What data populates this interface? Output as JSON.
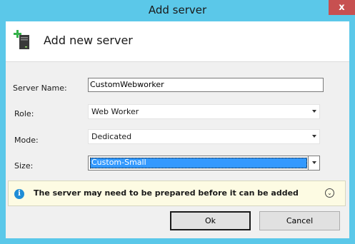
{
  "window": {
    "title": "Add server",
    "close_glyph": "x"
  },
  "header": {
    "title": "Add new server",
    "icon": "server-add-icon"
  },
  "form": {
    "server_name_label": "Server Name:",
    "server_name_value": "CustomWebworker",
    "role_label": "Role:",
    "role_value": "Web Worker",
    "mode_label": "Mode:",
    "mode_value": "Dedicated",
    "size_label": "Size:",
    "size_value": "Custom-Small"
  },
  "info": {
    "icon": "info-icon",
    "glyph": "i",
    "message": "The server may need to be prepared before it can be added",
    "expand_glyph": "⌄"
  },
  "buttons": {
    "ok": "Ok",
    "cancel": "Cancel"
  },
  "colors": {
    "chrome": "#5bc8e9",
    "close": "#c75050",
    "selection": "#3399ff",
    "info_bg": "#fdfbe3",
    "info_icon": "#1f8dd6"
  }
}
